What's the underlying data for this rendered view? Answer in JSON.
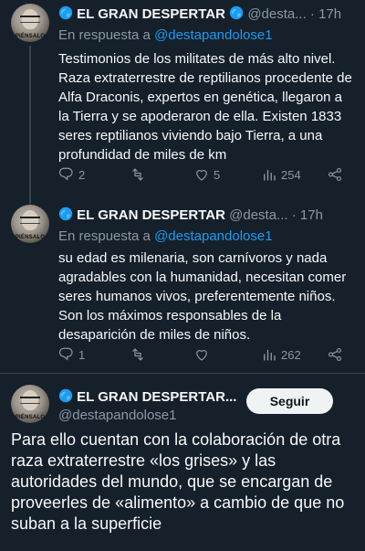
{
  "tweets": [
    {
      "name": "EL GRAN DESPERTAR",
      "handle": "@desta...",
      "dot": "·",
      "time": "17h",
      "reply_prefix": "En respuesta a ",
      "reply_to": "@destapandolose1",
      "text": "Testimonios de los militates de más alto nivel. Raza extraterrestre de reptilianos  procedente de Alfa Draconis, expertos en genética, llegaron a la Tierra y se apoderaron de ella. Existen 1833 seres reptilianos viviendo bajo Tierra, a una profundidad de miles de km",
      "replies": "2",
      "retweets": "",
      "likes": "5",
      "views": "254"
    },
    {
      "name": "EL GRAN DESPERTAR",
      "handle": "@desta...",
      "dot": "·",
      "time": "17h",
      "reply_prefix": "En respuesta a ",
      "reply_to": "@destapandolose1",
      "text": "su edad es milenaria, son carnívoros y nada agradables con la humanidad, necesitan comer seres humanos vivos, preferentemente niños. Son los máximos responsables de  la desaparición de miles de niños.",
      "replies": "1",
      "retweets": "",
      "likes": "",
      "views": "262"
    }
  ],
  "avatar_caption": "PIÉNSALO",
  "main_tweet": {
    "name": "EL GRAN DESPERTAR...",
    "handle": "@destapandolose1",
    "follow_label": "Seguir",
    "text": "Para ello cuentan con la colaboración de otra raza extraterrestre «los grises» y las autoridades del mundo,  que se encargan de proveerles de «alimento» a cambio de que no suban a la superficie"
  },
  "colors": {
    "background": "#15202b",
    "text": "#f7f9f9",
    "muted": "#8b98a5",
    "link": "#1d9bf0",
    "divider": "#38444d"
  },
  "icons": [
    "globe-icon",
    "reply-icon",
    "retweet-icon",
    "like-icon",
    "views-icon",
    "share-icon",
    "more-icon"
  ]
}
